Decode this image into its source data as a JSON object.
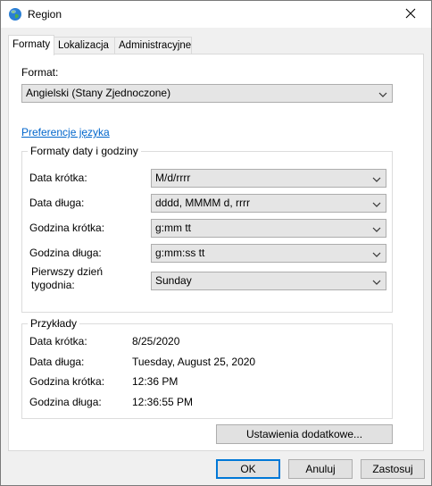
{
  "window": {
    "title": "Region",
    "app_icon": "globe-icon",
    "close_icon": "close-icon"
  },
  "tabs": [
    {
      "label": "Formaty",
      "active": true
    },
    {
      "label": "Lokalizacja",
      "active": false
    },
    {
      "label": "Administracyjne",
      "active": false
    }
  ],
  "format": {
    "label": "Format:",
    "value": "Angielski (Stany Zjednoczone)"
  },
  "language_link": "Preferencje języka",
  "date_time_formats": {
    "title": "Formaty daty i godziny",
    "short_date": {
      "label": "Data krótka:",
      "value": "M/d/rrrr"
    },
    "long_date": {
      "label": "Data długa:",
      "value": "dddd, MMMM d, rrrr"
    },
    "short_time": {
      "label": "Godzina krótka:",
      "value": "g:mm tt"
    },
    "long_time": {
      "label": "Godzina długa:",
      "value": "g:mm:ss tt"
    },
    "first_day": {
      "label_line1": "Pierwszy dzień",
      "label_line2": "tygodnia:",
      "value": "Sunday"
    }
  },
  "examples": {
    "title": "Przykłady",
    "short_date": {
      "label": "Data krótka:",
      "value": "8/25/2020"
    },
    "long_date": {
      "label": "Data długa:",
      "value": "Tuesday, August 25, 2020"
    },
    "short_time": {
      "label": "Godzina krótka:",
      "value": "12:36 PM"
    },
    "long_time": {
      "label": "Godzina długa:",
      "value": "12:36:55 PM"
    }
  },
  "buttons": {
    "additional_settings": "Ustawienia dodatkowe...",
    "ok": "OK",
    "cancel": "Anuluj",
    "apply": "Zastosuj"
  },
  "colors": {
    "link": "#0066cc",
    "default_button_border": "#0078d7"
  }
}
